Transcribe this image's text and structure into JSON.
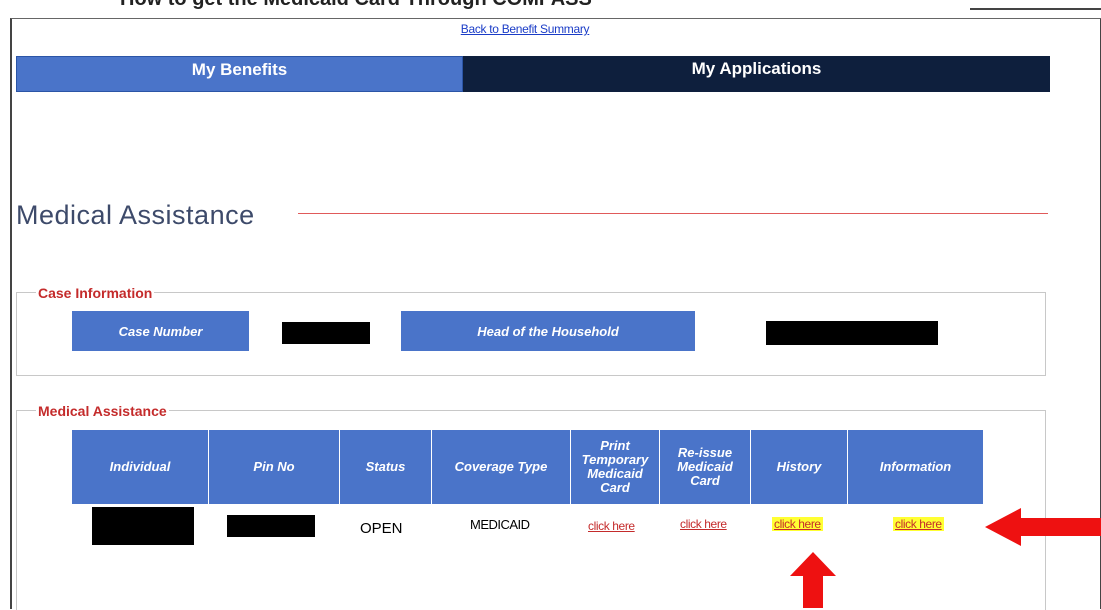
{
  "header": {
    "cut_title": "How to get the Medicaid Card Through COMPASS",
    "back_link": "Back to Benefit Summary"
  },
  "tabs": [
    {
      "label": "My Benefits",
      "active": true
    },
    {
      "label": "My Applications",
      "active": false
    }
  ],
  "section_title": "Medical Assistance",
  "case_info": {
    "legend": "Case Information",
    "case_number_label": "Case Number",
    "head_label": "Head of the Household"
  },
  "medical": {
    "legend": "Medical Assistance",
    "columns": [
      "Individual",
      "Pin No",
      "Status",
      "Coverage Type",
      "Print Temporary Medicaid Card",
      "Re-issue Medicaid Card",
      "History",
      "Information"
    ],
    "row": {
      "status": "OPEN",
      "coverage": "MEDICAID",
      "print_link": "click here",
      "reissue_link": "click here",
      "history_link": "click here",
      "information_link": "click here"
    }
  },
  "colors": {
    "tab_active": "#4a74c9",
    "tab_inactive": "#0e1f3d",
    "legend": "#c42b2b",
    "highlight": "#ffff33",
    "arrow": "#ee1111"
  }
}
